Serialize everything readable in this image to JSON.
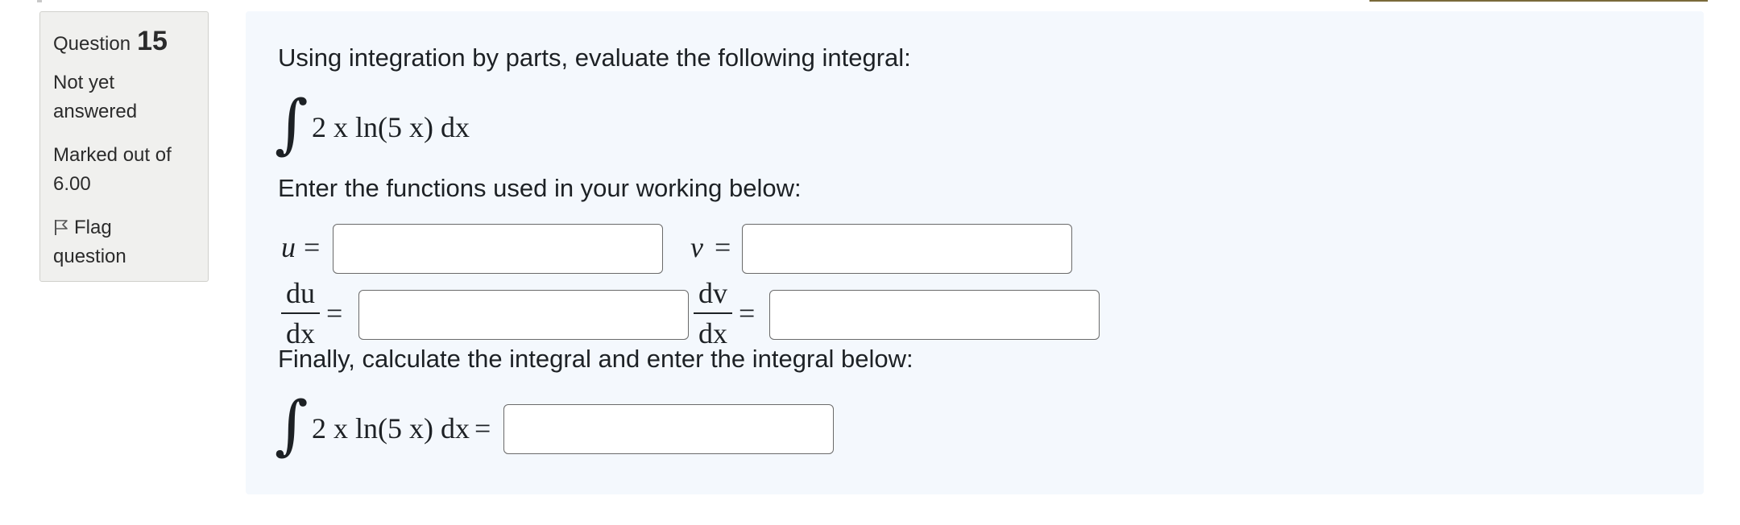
{
  "info": {
    "question_label": "Question",
    "question_number": "15",
    "state": "Not yet answered",
    "grade": "Marked out of 6.00",
    "flag_label": "Flag question"
  },
  "question": {
    "prompt": "Using integration by parts, evaluate the following integral:",
    "integral_integrand": "2 x ln(5 x) dx",
    "functions_prompt": "Enter the functions used in your working below:",
    "u_label": "u",
    "v_label": "v",
    "equals": "=",
    "du_num": "du",
    "dv_num": "dv",
    "dx_den": "dx",
    "final_prompt": "Finally, calculate the integral and enter the integral below:",
    "u_value": "",
    "v_value": "",
    "du_value": "",
    "dv_value": "",
    "answer_value": ""
  },
  "icons": {
    "flag": "flag-icon"
  }
}
